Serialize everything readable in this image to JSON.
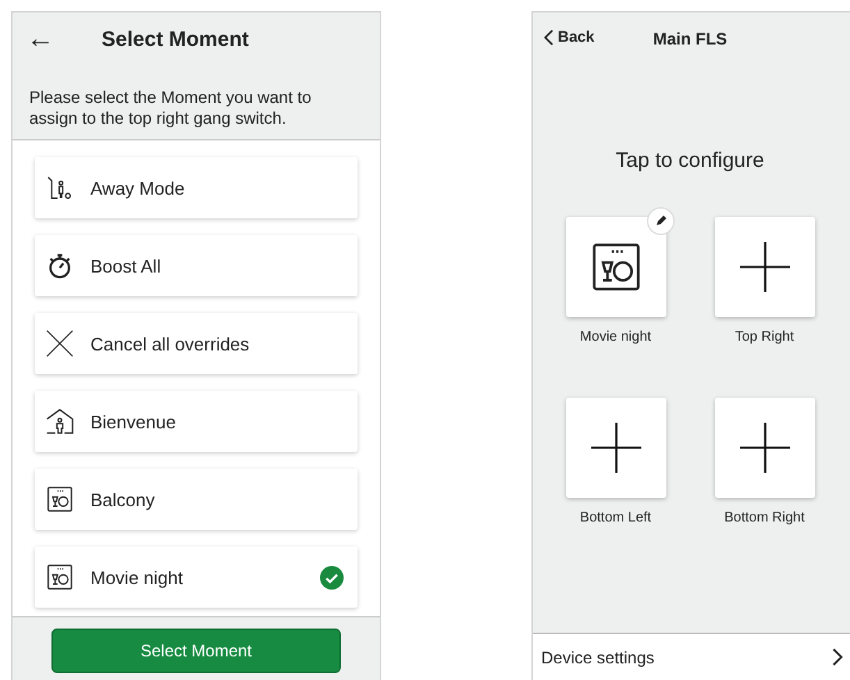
{
  "select_screen": {
    "back_icon": "←",
    "title": "Select Moment",
    "description": "Please select the Moment you want to assign to the top right gang switch.",
    "moments": [
      {
        "kind": "away",
        "label": "Away Mode",
        "selected": false
      },
      {
        "kind": "boost",
        "label": "Boost All",
        "selected": false
      },
      {
        "kind": "cancel",
        "label": "Cancel all overrides",
        "selected": false
      },
      {
        "kind": "welcome",
        "label": "Bienvenue",
        "selected": false
      },
      {
        "kind": "dining",
        "label": "Balcony",
        "selected": false
      },
      {
        "kind": "dining",
        "label": "Movie night",
        "selected": true
      }
    ],
    "button": "Select Moment"
  },
  "switch_screen": {
    "back": "Back",
    "title": "Main FLS",
    "prompt": "Tap to configure",
    "tiles": [
      {
        "kind": "moment",
        "label": "Movie night",
        "editable": true
      },
      {
        "kind": "empty",
        "label": "Top Right",
        "editable": false
      },
      {
        "kind": "empty",
        "label": "Bottom Left",
        "editable": false
      },
      {
        "kind": "empty",
        "label": "Bottom Right",
        "editable": false
      }
    ],
    "settings": "Device settings"
  }
}
